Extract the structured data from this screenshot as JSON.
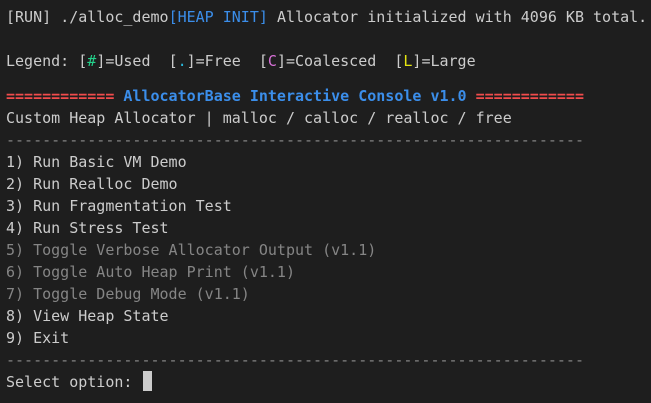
{
  "header": {
    "run_tag": "[RUN]",
    "run_cmd": "./alloc_demo",
    "heap_tag": "[HEAP INIT]",
    "heap_msg": "Allocator initialized with 4096 KB total."
  },
  "legend": {
    "prefix": "Legend:",
    "items": [
      {
        "open": "[",
        "sym": "#",
        "close": "]",
        "label": "=Used"
      },
      {
        "open": "[",
        "sym": ".",
        "close": "]",
        "label": "=Free"
      },
      {
        "open": "[",
        "sym": "C",
        "close": "]",
        "label": "=Coalesced"
      },
      {
        "open": "[",
        "sym": "L",
        "close": "]",
        "label": "=Large"
      }
    ]
  },
  "banner": {
    "left_bar": "============",
    "title": "AllocatorBase Interactive Console v1.0",
    "right_bar": "============",
    "subtitle": "Custom Heap Allocator | malloc / calloc / realloc / free"
  },
  "divider": "----------------------------------------------------------------",
  "menu": [
    {
      "text": "1) Run Basic VM Demo",
      "enabled": true
    },
    {
      "text": "2) Run Realloc Demo",
      "enabled": true
    },
    {
      "text": "3) Run Fragmentation Test",
      "enabled": true
    },
    {
      "text": "4) Run Stress Test",
      "enabled": true
    },
    {
      "text": "5) Toggle Verbose Allocator Output (v1.1)",
      "enabled": false
    },
    {
      "text": "6) Toggle Auto Heap Print (v1.1)",
      "enabled": false
    },
    {
      "text": "7) Toggle Debug Mode (v1.1)",
      "enabled": false
    },
    {
      "text": "8) View Heap State",
      "enabled": true
    },
    {
      "text": "9) Exit",
      "enabled": true
    }
  ],
  "prompt": {
    "label": "Select option:",
    "value": ""
  },
  "colors": {
    "background": "#1e1e1e",
    "text": "#cccccc",
    "tag_blue": "#3b8eea",
    "banner_red": "#f14c4c",
    "legend_used": "#23d18b",
    "legend_free": "#29b8db",
    "legend_coalesced": "#d670d6",
    "legend_large": "#e5e510",
    "disabled": "#858585"
  }
}
